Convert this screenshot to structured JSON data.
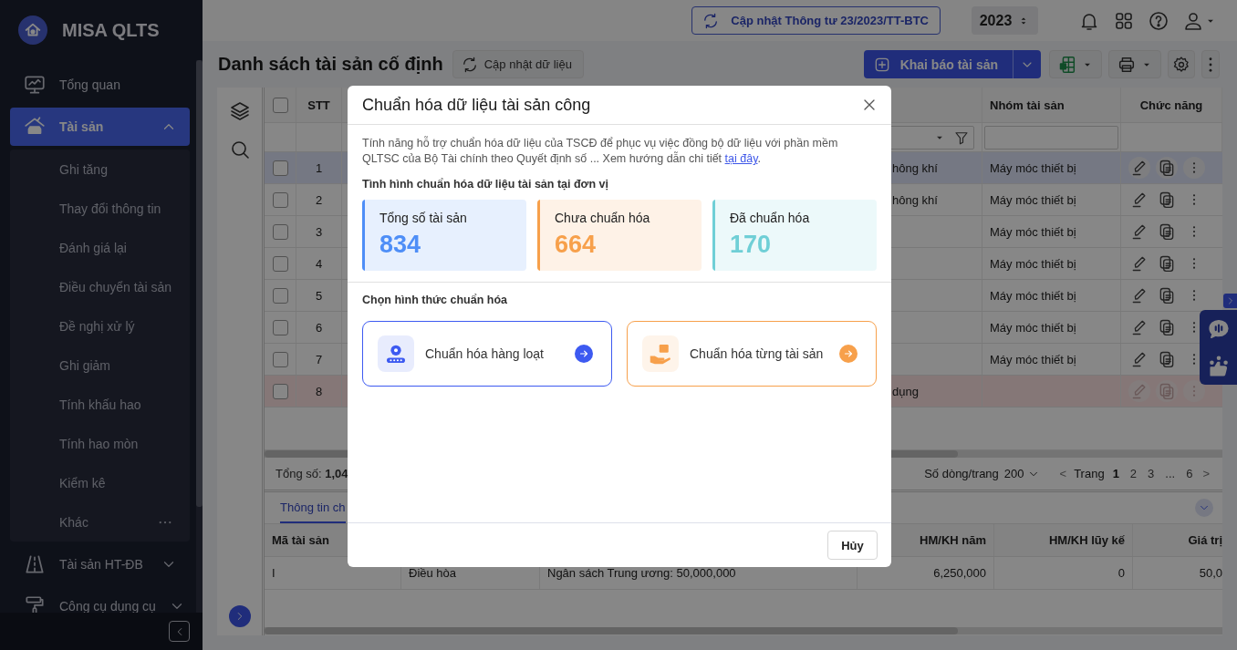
{
  "sidebar": {
    "brand": "MISA QLTS",
    "items": [
      {
        "label": "Tổng quan",
        "selected": false
      },
      {
        "label": "Tài sản",
        "selected": true,
        "expanded": true,
        "children": [
          {
            "label": "Ghi tăng",
            "selected": false,
            "more": false
          },
          {
            "label": "Thay đổi thông tin",
            "selected": false,
            "more": false
          },
          {
            "label": "Đánh giá lại",
            "selected": false,
            "more": false
          },
          {
            "label": "Điều chuyển tài sản",
            "selected": false,
            "more": false
          },
          {
            "label": "Đề nghị xử lý",
            "selected": false,
            "more": false
          },
          {
            "label": "Ghi giảm",
            "selected": false,
            "more": false
          },
          {
            "label": "Tính khấu hao",
            "selected": false,
            "more": false
          },
          {
            "label": "Tính hao mòn",
            "selected": false,
            "more": false
          },
          {
            "label": "Kiểm kê",
            "selected": false,
            "more": false
          },
          {
            "label": "Khác",
            "selected": false,
            "more": true
          }
        ]
      },
      {
        "label": "Tài sản HT-ĐB",
        "selected": false,
        "expanded": false
      },
      {
        "label": "Công cụ dụng cụ",
        "selected": false,
        "expanded": false
      }
    ]
  },
  "header": {
    "update_button": "Cập nhật Thông tư 23/2023/TT-BTC",
    "year": "2023"
  },
  "toolbar": {
    "title": "Danh sách tài sản cố định",
    "refresh_button": "Cập nhật dữ liệu",
    "primary_button": "Khai báo tài sản"
  },
  "table": {
    "header_checked": false,
    "columns": {
      "stt": "STT",
      "group": "Nhóm tài sản",
      "actions": "Chức năng"
    },
    "rows": [
      {
        "stt": "1",
        "column_3": "hông khí",
        "group": "Máy móc thiết bị",
        "checked": false,
        "selected": true,
        "flagged": false
      },
      {
        "stt": "2",
        "column_3": "hông khí",
        "group": "Máy móc thiết bị",
        "checked": false,
        "selected": false,
        "flagged": false
      },
      {
        "stt": "3",
        "group": "Máy móc thiết bị",
        "checked": false,
        "selected": false,
        "flagged": false
      },
      {
        "stt": "4",
        "group": "Máy móc thiết bị",
        "checked": false,
        "selected": false,
        "flagged": false
      },
      {
        "stt": "5",
        "group": "Máy móc thiết bị",
        "checked": false,
        "selected": false,
        "flagged": false
      },
      {
        "stt": "6",
        "group": "Máy móc thiết bị",
        "checked": false,
        "selected": false,
        "flagged": false
      },
      {
        "stt": "7",
        "group": "Máy móc thiết bị",
        "checked": false,
        "selected": false,
        "flagged": false
      },
      {
        "stt": "8",
        "column_3": "dụng",
        "checked": false,
        "selected": false,
        "flagged": true
      }
    ]
  },
  "pagination": {
    "total": "Tổng số: **1,04**",
    "page_size_label": "Số dòng/trang",
    "page_size": "200",
    "prev": "<",
    "page_label": "Trang",
    "pages": [
      {
        "label": "1",
        "selected": true
      },
      {
        "label": "2",
        "selected": false
      },
      {
        "label": "3",
        "selected": false
      },
      {
        "label": "...",
        "selected": false
      },
      {
        "label": "6",
        "selected": false
      }
    ],
    "next": ">"
  },
  "detail": {
    "tab": "Thông tin ch",
    "header": {
      "column_1": "Mã tài sản",
      "column_4": "HM/KH năm",
      "column_5": "HM/KH lũy kế",
      "column_6": "Giá trị"
    },
    "row": {
      "column_1": "I",
      "column_2": "Điều hòa",
      "column_3": "Ngân sách Trung ương: 50,000,000",
      "column_4": "6,250,000",
      "column_5": "0",
      "column_6": "50,0"
    }
  },
  "dialog": {
    "title": "Chuẩn hóa dữ liệu tài sản công",
    "description": "Tính năng hỗ trợ chuẩn hóa dữ liệu của TSCĐ để phục vụ việc đồng bộ dữ liệu với phần mềm QLTSC của Bộ Tài chính theo Quyết định số ... Xem hướng dẫn chi tiết",
    "link": "tại đây",
    "link_suffix": ".",
    "status_title": "Tình hình chuẩn hóa dữ liệu tài sản tại đơn vị",
    "stats": [
      {
        "label": "Tổng số tài sản",
        "value": "834",
        "color": "#4e8ef7"
      },
      {
        "label": "Chưa chuẩn hóa",
        "value": "664",
        "color": "#f7a04b"
      },
      {
        "label": "Đã chuẩn hóa",
        "value": "170",
        "color": "#6fcfd6"
      }
    ],
    "options_title": "Chọn hình thức chuẩn hóa",
    "options": [
      {
        "label": "Chuẩn hóa hàng loạt",
        "color": "#3d5af1"
      },
      {
        "label": "Chuẩn hóa từng tài sản",
        "color": "#f7a04b"
      }
    ],
    "cancel": "Hủy"
  }
}
